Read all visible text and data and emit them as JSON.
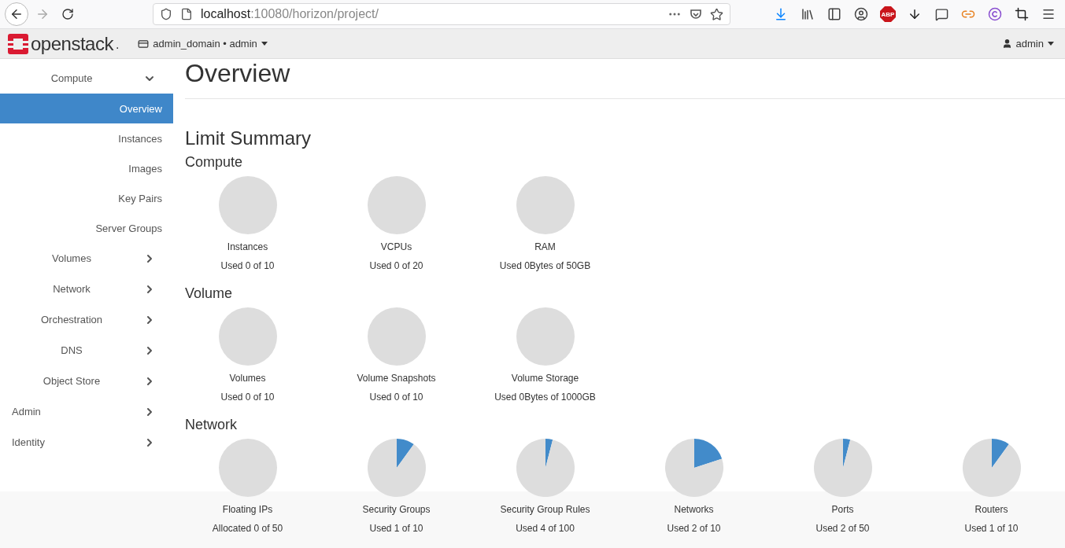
{
  "browser": {
    "url_host": "localhost",
    "url_path": ":10080/horizon/project/",
    "adblock_badge": "ABP"
  },
  "header": {
    "logo_text": "openstack",
    "logo_dot": ".",
    "project": "admin_domain • admin",
    "user": "admin"
  },
  "sidebar": {
    "project_panels": [
      {
        "label": "Compute",
        "expanded": true,
        "children": [
          {
            "label": "Overview",
            "selected": true
          },
          {
            "label": "Instances",
            "selected": false
          },
          {
            "label": "Images",
            "selected": false
          },
          {
            "label": "Key Pairs",
            "selected": false
          },
          {
            "label": "Server Groups",
            "selected": false
          }
        ]
      },
      {
        "label": "Volumes",
        "expanded": false
      },
      {
        "label": "Network",
        "expanded": false
      },
      {
        "label": "Orchestration",
        "expanded": false
      },
      {
        "label": "DNS",
        "expanded": false
      },
      {
        "label": "Object Store",
        "expanded": false
      }
    ],
    "dashboards": [
      {
        "label": "Admin",
        "expanded": false
      },
      {
        "label": "Identity",
        "expanded": false
      }
    ]
  },
  "content": {
    "title": "Overview",
    "subtitle": "Limit Summary",
    "sections": [
      {
        "title": "Compute",
        "quotas": [
          {
            "name": "Instances",
            "usage": "Used 0 of 10",
            "chart_data": {
              "type": "pie",
              "values": [
                0,
                100
              ]
            }
          },
          {
            "name": "VCPUs",
            "usage": "Used 0 of 20",
            "chart_data": {
              "type": "pie",
              "values": [
                0,
                100
              ]
            }
          },
          {
            "name": "RAM",
            "usage": "Used 0Bytes of 50GB",
            "chart_data": {
              "type": "pie",
              "values": [
                0,
                100
              ]
            }
          }
        ]
      },
      {
        "title": "Volume",
        "quotas": [
          {
            "name": "Volumes",
            "usage": "Used 0 of 10",
            "chart_data": {
              "type": "pie",
              "values": [
                0,
                100
              ]
            }
          },
          {
            "name": "Volume Snapshots",
            "usage": "Used 0 of 10",
            "chart_data": {
              "type": "pie",
              "values": [
                0,
                100
              ]
            }
          },
          {
            "name": "Volume Storage",
            "usage": "Used 0Bytes of 1000GB",
            "chart_data": {
              "type": "pie",
              "values": [
                0,
                100
              ]
            }
          }
        ]
      },
      {
        "title": "Network",
        "quotas": [
          {
            "name": "Floating IPs",
            "usage": "Allocated 0 of 50",
            "chart_data": {
              "type": "pie",
              "values": [
                0,
                100
              ]
            }
          },
          {
            "name": "Security Groups",
            "usage": "Used 1 of 10",
            "chart_data": {
              "type": "pie",
              "values": [
                10,
                90
              ]
            }
          },
          {
            "name": "Security Group Rules",
            "usage": "Used 4 of 100",
            "chart_data": {
              "type": "pie",
              "values": [
                4,
                96
              ]
            }
          },
          {
            "name": "Networks",
            "usage": "Used 2 of 10",
            "chart_data": {
              "type": "pie",
              "values": [
                20,
                80
              ]
            }
          },
          {
            "name": "Ports",
            "usage": "Used 2 of 50",
            "chart_data": {
              "type": "pie",
              "values": [
                4,
                96
              ]
            }
          },
          {
            "name": "Routers",
            "usage": "Used 1 of 10",
            "chart_data": {
              "type": "pie",
              "values": [
                10,
                90
              ]
            }
          }
        ]
      }
    ]
  }
}
